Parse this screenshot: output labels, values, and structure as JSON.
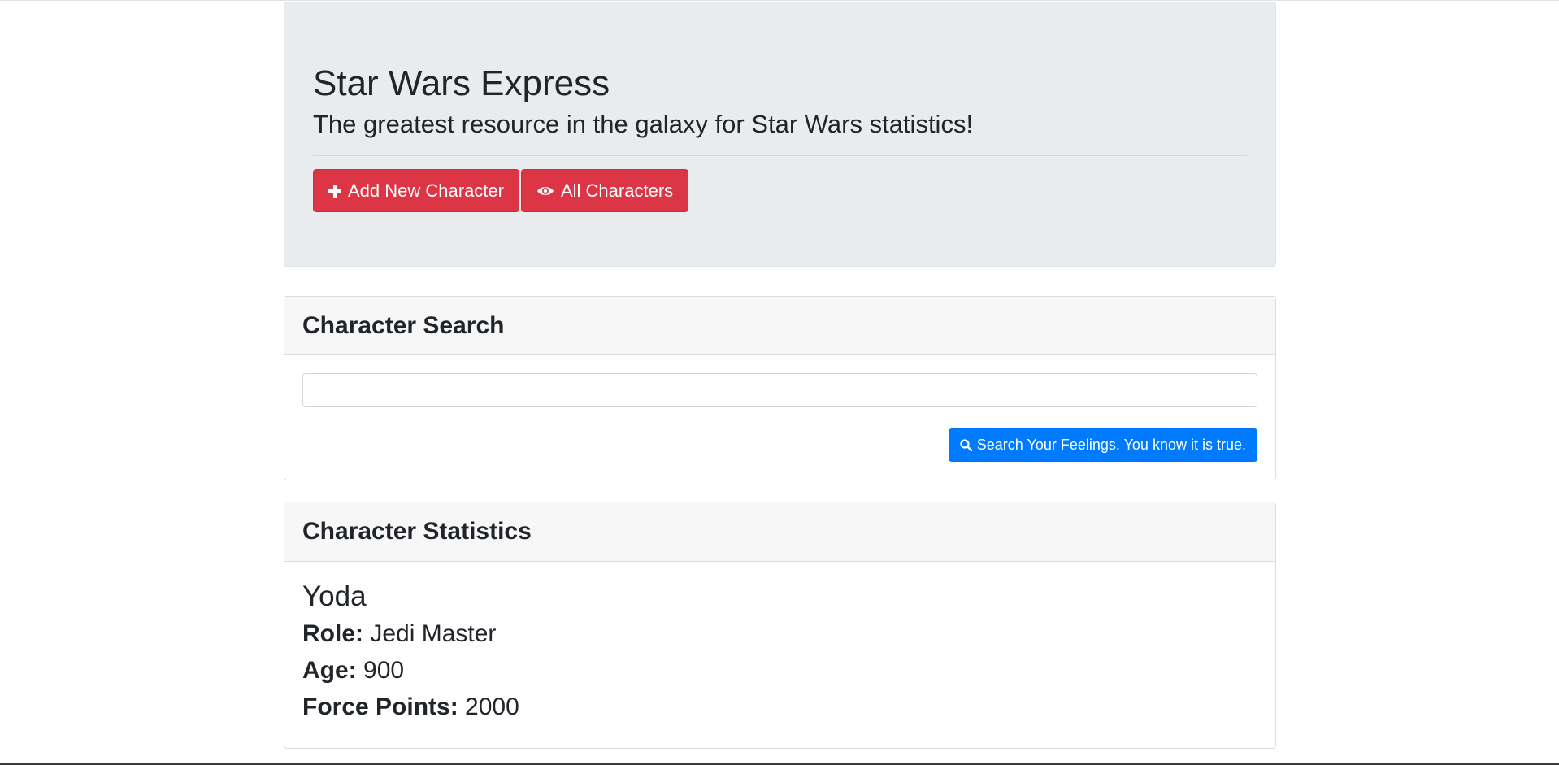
{
  "jumbotron": {
    "title": "Star Wars Express",
    "lead": "The greatest resource in the galaxy for Star Wars statistics!",
    "buttons": {
      "add_label": "Add New Character",
      "all_label": "All Characters"
    }
  },
  "search": {
    "header": "Character Search",
    "input_value": "",
    "button_label": "Search Your Feelings. You know it is true."
  },
  "stats": {
    "header": "Character Statistics",
    "character": {
      "name": "Yoda",
      "role_label": "Role:",
      "role": "Jedi Master",
      "age_label": "Age:",
      "age": "900",
      "force_label": "Force Points:",
      "force": "2000"
    }
  },
  "icons": {
    "add": "plus-icon",
    "all": "eye-icon",
    "search": "search-icon"
  },
  "colors": {
    "danger": "#dc3545",
    "primary": "#007bff",
    "jumbotron_bg": "#e9ecef"
  }
}
